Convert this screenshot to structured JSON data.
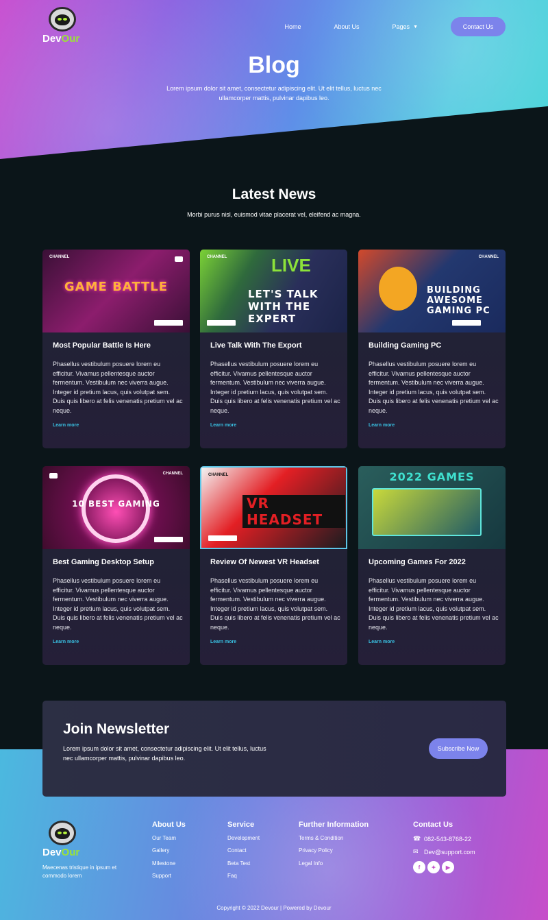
{
  "brand": {
    "dev": "Dev",
    "our": "Our"
  },
  "nav": {
    "home": "Home",
    "about": "About Us",
    "pages": "Pages",
    "contact": "Contact Us"
  },
  "hero": {
    "title": "Blog",
    "subtitle": "Lorem ipsum dolor sit amet, consectetur adipiscing elit. Ut elit tellus, luctus nec ullamcorper mattis, pulvinar dapibus leo."
  },
  "news": {
    "title": "Latest News",
    "subtitle": "Morbi purus nisl, euismod vitae placerat vel, eleifend ac magna.",
    "link_label": "Learn more",
    "body": "Phasellus vestibulum posuere lorem eu efficitur. Vivamus pellentesque auctor fermentum. Vestibulum nec viverra augue. Integer id pretium lacus, quis volutpat sem. Duis quis libero at felis venenatis pretium vel ac neque.",
    "cards": [
      {
        "title": "Most Popular Battle Is Here",
        "thumb": "GAME BATTLE",
        "channel": "CHANNEL"
      },
      {
        "title": "Live Talk With The Export",
        "thumb": "LET'S TALK WITH THE EXPERT",
        "extra": "LIVE",
        "channel": "CHANNEL"
      },
      {
        "title": "Building Gaming PC",
        "thumb": "BUILDING AWESOME GAMING PC",
        "channel": "CHANNEL"
      },
      {
        "title": "Best Gaming Desktop Setup",
        "thumb": "10 BEST GAMING",
        "channel": "CHANNEL"
      },
      {
        "title": "Review Of Newest VR Headset",
        "thumb": "VR HEADSET",
        "channel": "CHANNEL"
      },
      {
        "title": "Upcoming Games For 2022",
        "thumb": "2022 GAMES"
      }
    ]
  },
  "newsletter": {
    "title": "Join Newsletter",
    "text": "Lorem ipsum dolor sit amet, consectetur adipiscing elit. Ut elit tellus, luctus nec ullamcorper mattis, pulvinar dapibus leo.",
    "button": "Subscribe Now"
  },
  "footer": {
    "description": "Maecenas tristique in ipsum et commodo lorem",
    "about": {
      "title": "About Us",
      "items": [
        "Our Team",
        "Gallery",
        "Milestone",
        "Support"
      ]
    },
    "service": {
      "title": "Service",
      "items": [
        "Development",
        "Contact",
        "Beta Test",
        "Faq"
      ]
    },
    "info": {
      "title": "Further Information",
      "items": [
        "Terms & Condition",
        "Privacy Policy",
        "Legal Info"
      ]
    },
    "contact": {
      "title": "Contact Us",
      "phone": "082-543-8768-22",
      "email": "Dev@support.com"
    },
    "copyright": "Copyright © 2022 Devour | Powered by Devour"
  },
  "icons": {
    "phone": "phone-icon",
    "email": "envelope-icon",
    "facebook": "facebook-icon",
    "twitter": "twitter-icon",
    "youtube": "youtube-icon"
  },
  "colors": {
    "accent": "#7c83eb",
    "link": "#39c4e6",
    "logo_green": "#9be336",
    "background": "#0b1519"
  }
}
